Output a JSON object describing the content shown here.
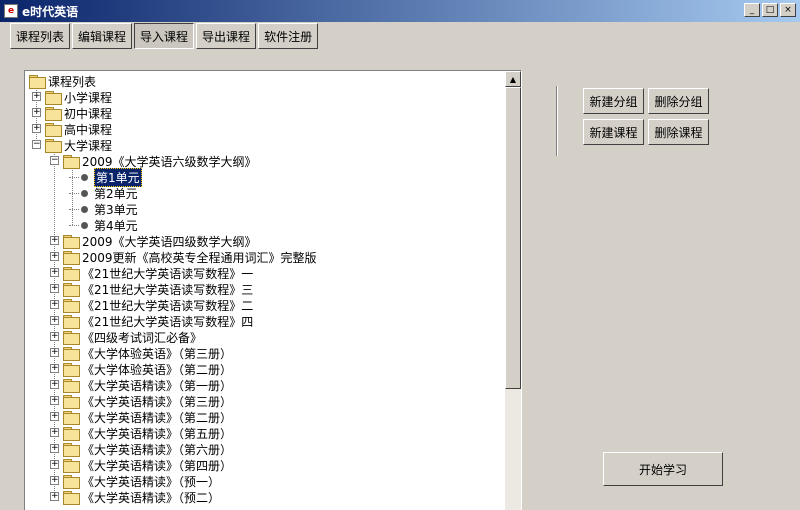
{
  "window": {
    "title": "e时代英语",
    "icon": "app-icon",
    "controls": [
      "_",
      "□",
      "×"
    ]
  },
  "toolbar": [
    {
      "label": "课程列表",
      "pressed": false
    },
    {
      "label": "编辑课程",
      "pressed": false
    },
    {
      "label": "导入课程",
      "pressed": true
    },
    {
      "label": "导出课程",
      "pressed": false
    },
    {
      "label": "软件注册",
      "pressed": false
    }
  ],
  "tree": [
    {
      "label": "课程列表",
      "depth": 0,
      "type": "folder",
      "expander": "none"
    },
    {
      "label": "小学课程",
      "depth": 1,
      "type": "folder",
      "expander": "+"
    },
    {
      "label": "初中课程",
      "depth": 1,
      "type": "folder",
      "expander": "+"
    },
    {
      "label": "高中课程",
      "depth": 1,
      "type": "folder",
      "expander": "+"
    },
    {
      "label": "大学课程",
      "depth": 1,
      "type": "folder",
      "expander": "-"
    },
    {
      "label": "2009《大学英语六级数学大纲》",
      "depth": 2,
      "type": "folder",
      "expander": "-"
    },
    {
      "label": "第1单元",
      "depth": 3,
      "type": "leaf",
      "selected": true
    },
    {
      "label": "第2单元",
      "depth": 3,
      "type": "leaf"
    },
    {
      "label": "第3单元",
      "depth": 3,
      "type": "leaf"
    },
    {
      "label": "第4单元",
      "depth": 3,
      "type": "leaf"
    },
    {
      "label": "2009《大学英语四级数学大纲》",
      "depth": 2,
      "type": "folder",
      "expander": "+"
    },
    {
      "label": "2009更新《高校英专全程通用词汇》完整版",
      "depth": 2,
      "type": "folder",
      "expander": "+"
    },
    {
      "label": "《21世纪大学英语读写数程》一",
      "depth": 2,
      "type": "folder",
      "expander": "+"
    },
    {
      "label": "《21世纪大学英语读写数程》三",
      "depth": 2,
      "type": "folder",
      "expander": "+"
    },
    {
      "label": "《21世纪大学英语读写数程》二",
      "depth": 2,
      "type": "folder",
      "expander": "+"
    },
    {
      "label": "《21世纪大学英语读写数程》四",
      "depth": 2,
      "type": "folder",
      "expander": "+"
    },
    {
      "label": "《四级考试词汇必备》",
      "depth": 2,
      "type": "folder",
      "expander": "+"
    },
    {
      "label": "《大学体验英语》（第三册）",
      "depth": 2,
      "type": "folder",
      "expander": "+"
    },
    {
      "label": "《大学体验英语》（第二册）",
      "depth": 2,
      "type": "folder",
      "expander": "+"
    },
    {
      "label": "《大学英语精读》（第一册）",
      "depth": 2,
      "type": "folder",
      "expander": "+"
    },
    {
      "label": "《大学英语精读》（第三册）",
      "depth": 2,
      "type": "folder",
      "expander": "+"
    },
    {
      "label": "《大学英语精读》（第二册）",
      "depth": 2,
      "type": "folder",
      "expander": "+"
    },
    {
      "label": "《大学英语精读》（第五册）",
      "depth": 2,
      "type": "folder",
      "expander": "+"
    },
    {
      "label": "《大学英语精读》（第六册）",
      "depth": 2,
      "type": "folder",
      "expander": "+"
    },
    {
      "label": "《大学英语精读》（第四册）",
      "depth": 2,
      "type": "folder",
      "expander": "+"
    },
    {
      "label": "《大学英语精读》（预一）",
      "depth": 2,
      "type": "folder",
      "expander": "+"
    },
    {
      "label": "《大学英语精读》（预二）",
      "depth": 2,
      "type": "folder",
      "expander": "+"
    }
  ],
  "actions": {
    "new_group": "新建分组",
    "delete_group": "删除分组",
    "new_course": "新建课程",
    "delete_course": "删除课程",
    "start": "开始学习"
  },
  "colors": {
    "title_start": "#0a246a",
    "title_end": "#a6caf0",
    "selection": "#0a246a",
    "face": "#d4d0c8"
  }
}
